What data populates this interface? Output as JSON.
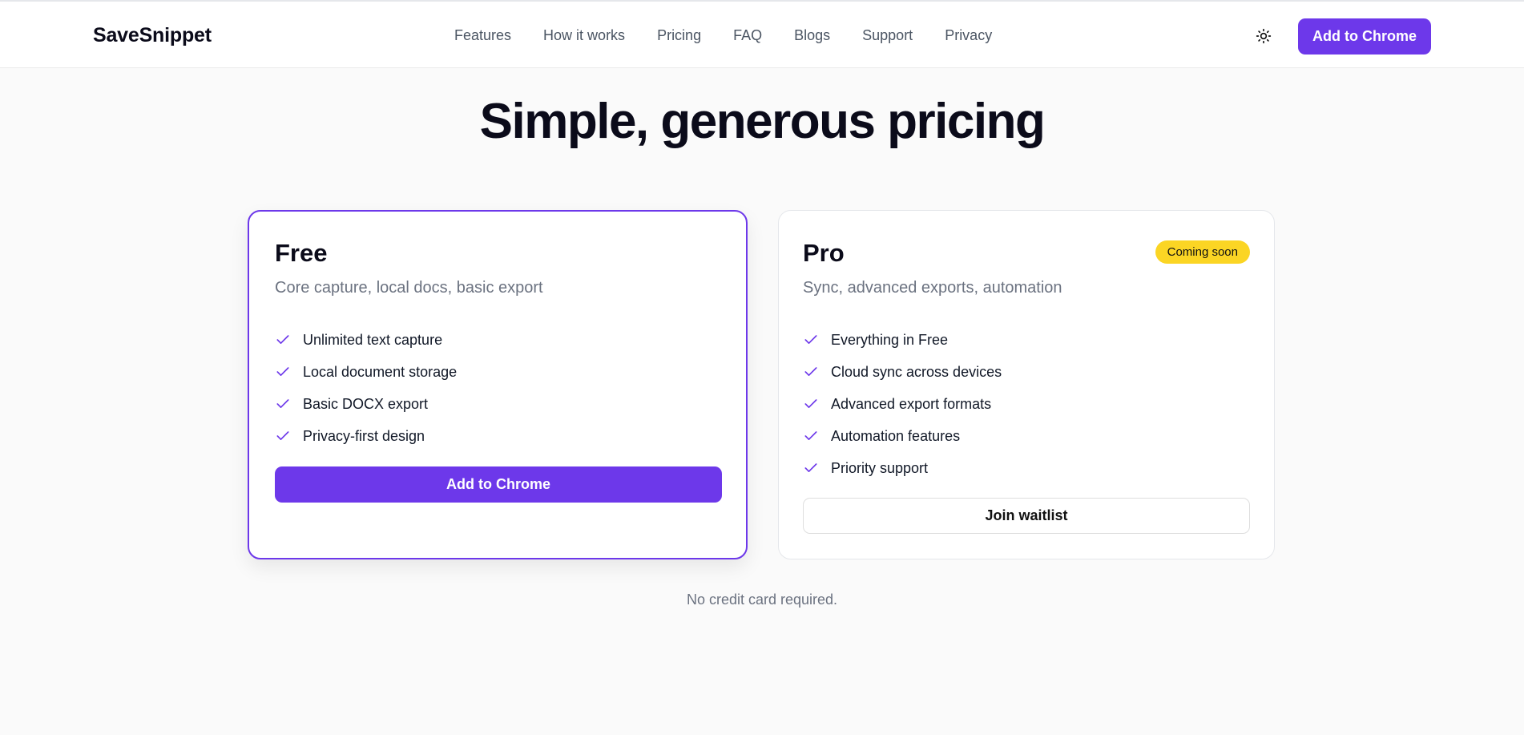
{
  "header": {
    "brand": "SaveSnippet",
    "nav": [
      "Features",
      "How it works",
      "Pricing",
      "FAQ",
      "Blogs",
      "Support",
      "Privacy"
    ],
    "theme_icon": "sun-icon",
    "cta_label": "Add to Chrome"
  },
  "main": {
    "title": "Simple, generous pricing",
    "plans": [
      {
        "name": "Free",
        "description": "Core capture, local docs, basic export",
        "features": [
          "Unlimited text capture",
          "Local document storage",
          "Basic DOCX export",
          "Privacy-first design"
        ],
        "button": "Add to Chrome"
      },
      {
        "name": "Pro",
        "badge": "Coming soon",
        "description": "Sync, advanced exports, automation",
        "features": [
          "Everything in Free",
          "Cloud sync across devices",
          "Advanced export formats",
          "Automation features",
          "Priority support"
        ],
        "button": "Join waitlist"
      }
    ],
    "footnote": "No credit card required."
  },
  "colors": {
    "accent": "#6d38ea",
    "badge": "#fbd524",
    "text": "#0b0b1a",
    "muted": "#6b7280",
    "background": "#fafafa"
  }
}
